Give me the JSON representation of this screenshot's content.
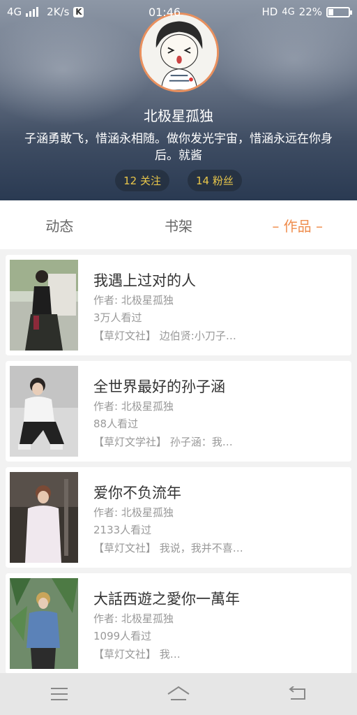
{
  "status_bar": {
    "network": "4G",
    "speed": "2K/s",
    "app_badge": "K",
    "time": "01:46",
    "hd": "HD",
    "network_right": "4G",
    "battery_text": "22%",
    "battery_level": 0.22
  },
  "profile": {
    "username": "北极星孤独",
    "bio": "子涵勇敢飞，惜涵永相随。做你发光宇宙，惜涵永远在你身后。就酱",
    "following": "12 关注",
    "followers": "14 粉丝"
  },
  "tabs": [
    {
      "label": "动态",
      "active": false
    },
    {
      "label": "书架",
      "active": false
    },
    {
      "label": "– 作品 –",
      "active": true
    }
  ],
  "books": [
    {
      "title": "我遇上过对的人",
      "author": "作者: 北极星孤独",
      "views": "3万人看过",
      "tagline": "【草灯文社】 边伯贤:小刀子…"
    },
    {
      "title": "全世界最好的孙子涵",
      "author": "作者: 北极星孤独",
      "views": "88人看过",
      "tagline": "【草灯文学社】 孙子涵：我…"
    },
    {
      "title": "爱你不负流年",
      "author": "作者: 北极星孤独",
      "views": "2133人看过",
      "tagline": "【草灯文社】 我说，我并不喜…"
    },
    {
      "title": "大話西遊之愛你一萬年",
      "author": "作者: 北极星孤独",
      "views": "1099人看过",
      "tagline": "【草灯文社】 我…"
    }
  ],
  "colors": {
    "accent": "#ef8d4e",
    "pill_text": "#e8c64a"
  }
}
